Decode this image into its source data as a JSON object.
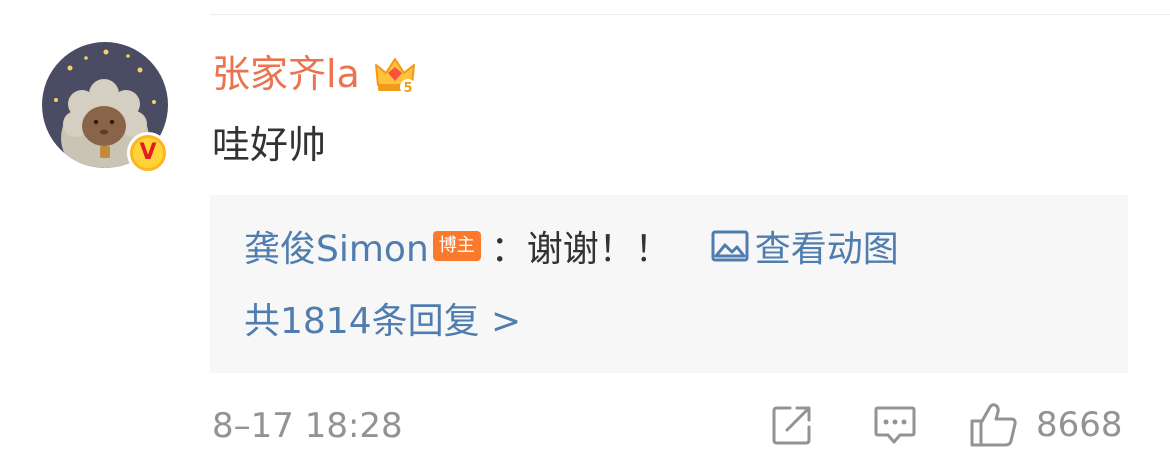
{
  "comment": {
    "username": "张家齐la",
    "text": "哇好帅",
    "avatar_icon": "sheep-avatar-icon",
    "verified_badge": "V",
    "member_icon": "vip-crown-icon",
    "member_level": "5"
  },
  "reply_preview": {
    "author": "龚俊Simon",
    "author_badge": "博主",
    "colon": "：",
    "text": "谢谢！！",
    "image_link_icon": "image-icon",
    "image_link_label": "查看动图",
    "total_replies_label": "共1814条回复 >"
  },
  "footer": {
    "timestamp": "8–17 18:28",
    "like_count": "8668"
  },
  "colors": {
    "username": "#eb7350",
    "link": "#507daf",
    "muted": "#939393",
    "reply_bg": "#f7f7f7",
    "badge_orange": "#f97a2c"
  }
}
